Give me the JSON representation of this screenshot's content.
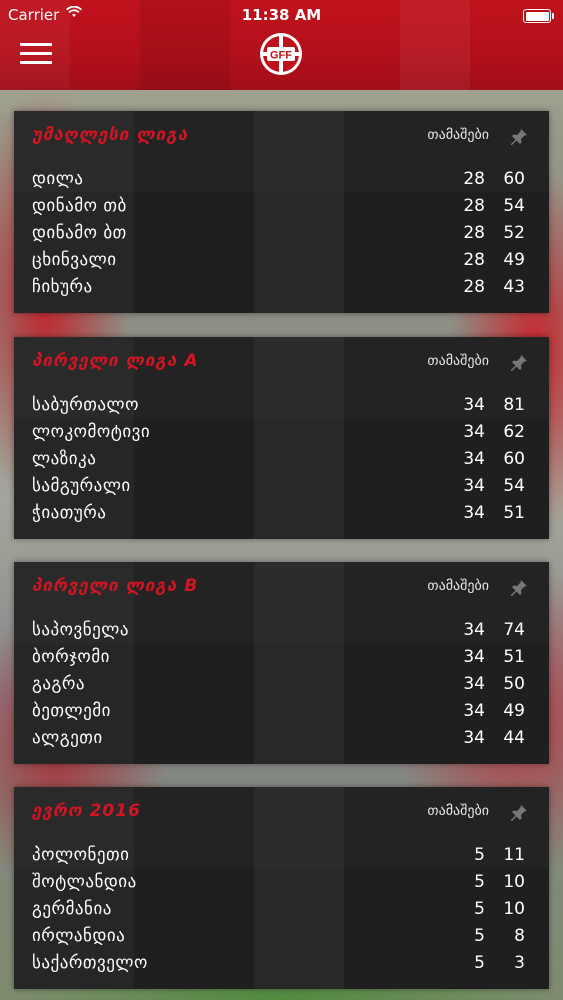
{
  "status_bar": {
    "carrier": "Carrier",
    "time": "11:38 AM"
  },
  "header": {
    "logo_text": "GFF"
  },
  "leagues": [
    {
      "title": "უმაღლესი ლიგა",
      "games_header": "თამაშები",
      "rows": [
        {
          "team": "დილა",
          "games": "28",
          "points": "60"
        },
        {
          "team": "დინამო თბ",
          "games": "28",
          "points": "54"
        },
        {
          "team": "დინამო ბთ",
          "games": "28",
          "points": "52"
        },
        {
          "team": "ცხინვალი",
          "games": "28",
          "points": "49"
        },
        {
          "team": "ჩიხურა",
          "games": "28",
          "points": "43"
        }
      ]
    },
    {
      "title": "პირველი ლიგა A",
      "games_header": "თამაშები",
      "rows": [
        {
          "team": "საბურთალო",
          "games": "34",
          "points": "81"
        },
        {
          "team": "ლოკომოტივი",
          "games": "34",
          "points": "62"
        },
        {
          "team": "ლაზიკა",
          "games": "34",
          "points": "60"
        },
        {
          "team": "სამგურალი",
          "games": "34",
          "points": "54"
        },
        {
          "team": "ჭიათურა",
          "games": "34",
          "points": "51"
        }
      ]
    },
    {
      "title": "პირველი ლიგა B",
      "games_header": "თამაშები",
      "rows": [
        {
          "team": "საპოვნელა",
          "games": "34",
          "points": "74"
        },
        {
          "team": "ბორჯომი",
          "games": "34",
          "points": "51"
        },
        {
          "team": "გაგრა",
          "games": "34",
          "points": "50"
        },
        {
          "team": "ბეთლემი",
          "games": "34",
          "points": "49"
        },
        {
          "team": "ალგეთი",
          "games": "34",
          "points": "44"
        }
      ]
    },
    {
      "title": "ევრო 2016",
      "games_header": "თამაშები",
      "rows": [
        {
          "team": "პოლონეთი",
          "games": "5",
          "points": "11"
        },
        {
          "team": "შოტლანდია",
          "games": "5",
          "points": "10"
        },
        {
          "team": "გერმანია",
          "games": "5",
          "points": "10"
        },
        {
          "team": "ირლანდია",
          "games": "5",
          "points": "8"
        },
        {
          "team": "საქართველო",
          "games": "5",
          "points": "3"
        }
      ]
    }
  ],
  "colors": {
    "accent": "#d31523",
    "header": "#b3101a",
    "card": "#1f1f20"
  },
  "icons": {
    "menu": "hamburger-menu-icon",
    "pin": "pin-icon",
    "wifi": "wifi-icon",
    "battery": "battery-icon"
  }
}
